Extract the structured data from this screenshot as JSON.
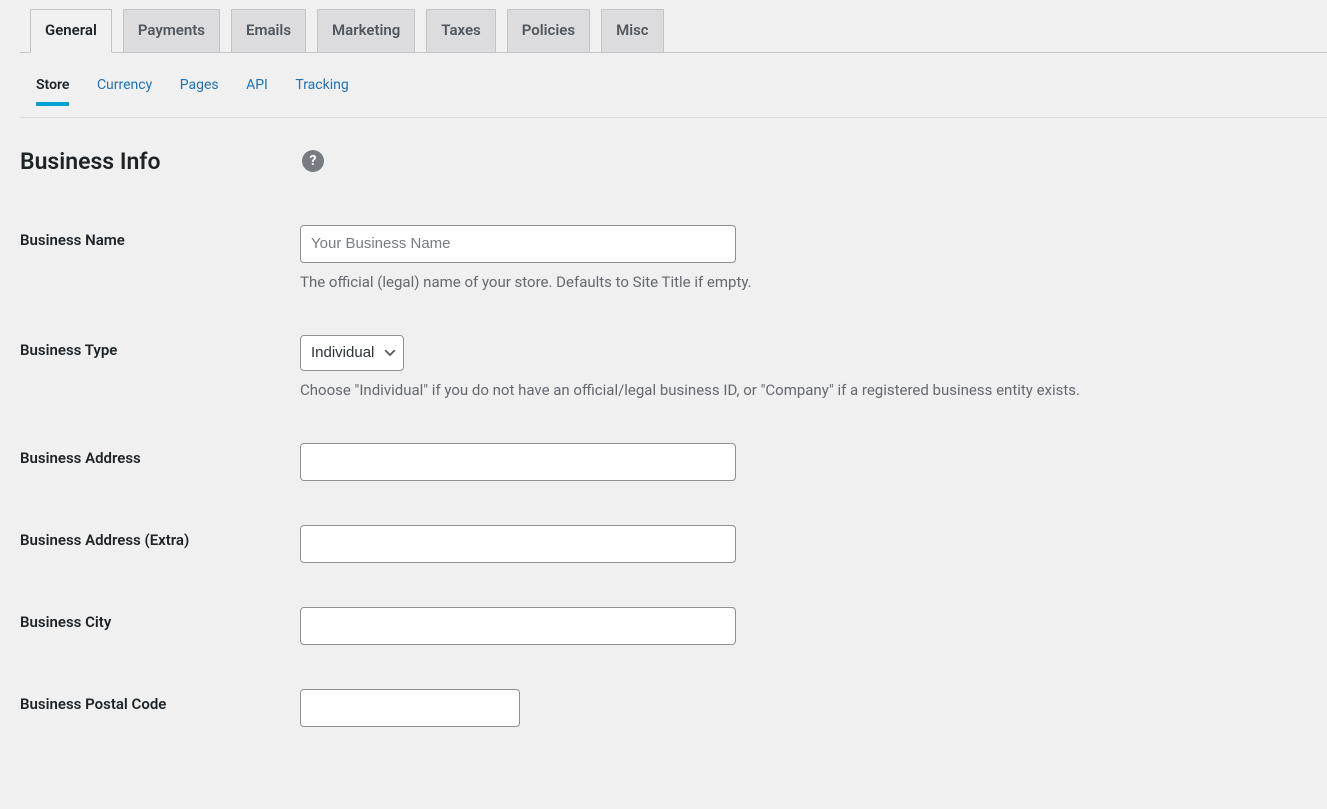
{
  "main_tabs": [
    {
      "label": "General",
      "active": true
    },
    {
      "label": "Payments",
      "active": false
    },
    {
      "label": "Emails",
      "active": false
    },
    {
      "label": "Marketing",
      "active": false
    },
    {
      "label": "Taxes",
      "active": false
    },
    {
      "label": "Policies",
      "active": false
    },
    {
      "label": "Misc",
      "active": false
    }
  ],
  "sub_tabs": [
    {
      "label": "Store",
      "active": true
    },
    {
      "label": "Currency",
      "active": false
    },
    {
      "label": "Pages",
      "active": false
    },
    {
      "label": "API",
      "active": false
    },
    {
      "label": "Tracking",
      "active": false
    }
  ],
  "section": {
    "heading": "Business Info"
  },
  "fields": {
    "business_name": {
      "label": "Business Name",
      "placeholder": "Your Business Name",
      "value": "",
      "description": "The official (legal) name of your store. Defaults to Site Title if empty."
    },
    "business_type": {
      "label": "Business Type",
      "selected": "Individual",
      "description": "Choose \"Individual\" if you do not have an official/legal business ID, or \"Company\" if a registered business entity exists."
    },
    "business_address": {
      "label": "Business Address",
      "value": ""
    },
    "business_address_extra": {
      "label": "Business Address (Extra)",
      "value": ""
    },
    "business_city": {
      "label": "Business City",
      "value": ""
    },
    "business_postal_code": {
      "label": "Business Postal Code",
      "value": ""
    }
  }
}
